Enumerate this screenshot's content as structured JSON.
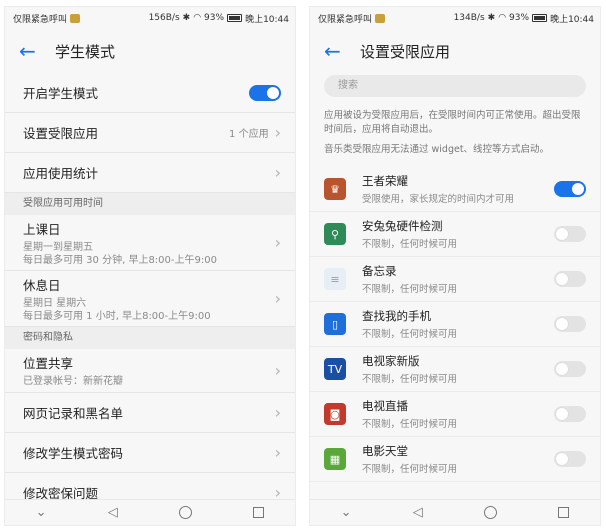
{
  "status_left": {
    "carrier": "仅限紧急呼叫",
    "speed": "156B/s",
    "battery": "93%",
    "time": "晚上10:44"
  },
  "status_right": {
    "carrier": "仅限紧急呼叫",
    "speed": "134B/s",
    "battery": "93%",
    "time": "晚上10:44"
  },
  "left": {
    "title": "学生模式",
    "rows_top": [
      {
        "title": "开启学生模式"
      },
      {
        "title": "设置受限应用",
        "value": "1 个应用"
      },
      {
        "title": "应用使用统计"
      }
    ],
    "section1": "受限应用可用时间",
    "schedule": [
      {
        "title": "上课日",
        "sub1": "星期一到星期五",
        "sub2": "每日最多可用 30 分钟, 早上8:00-上午9:00"
      },
      {
        "title": "休息日",
        "sub1": "星期日 星期六",
        "sub2": "每日最多可用 1 小时, 早上8:00-上午9:00"
      }
    ],
    "section2": "密码和隐私",
    "privacy": [
      {
        "title": "位置共享",
        "sub": "已登录帐号：新新花瓣"
      },
      {
        "title": "网页记录和黑名单"
      },
      {
        "title": "修改学生模式密码"
      },
      {
        "title": "修改密保问题"
      }
    ],
    "student_mode_on": true
  },
  "right": {
    "title": "设置受限应用",
    "search_placeholder": "搜索",
    "note1": "应用被设为受限应用后，在受限时间内可正常使用。超出受限时间后，应用将自动退出。",
    "note2": "音乐类受限应用无法通过 widget、线控等方式启动。",
    "apps": [
      {
        "name": "王者荣耀",
        "desc": "受限使用，家长规定的时间内才可用",
        "on": true,
        "icon": "game-icon",
        "color": "#b8552f"
      },
      {
        "name": "安兔兔硬件检测",
        "desc": "不限制，任何时候可用",
        "on": false,
        "icon": "magnifier-icon",
        "color": "#2e8b57"
      },
      {
        "name": "备忘录",
        "desc": "不限制，任何时候可用",
        "on": false,
        "icon": "memo-icon",
        "color": "#e8eef6"
      },
      {
        "name": "查找我的手机",
        "desc": "不限制，任何时候可用",
        "on": false,
        "icon": "phone-icon",
        "color": "#1e6fd9"
      },
      {
        "name": "电视家新版",
        "desc": "不限制，任何时候可用",
        "on": false,
        "icon": "tv-icon",
        "color": "#1b4fa3"
      },
      {
        "name": "电视直播",
        "desc": "不限制，任何时候可用",
        "on": false,
        "icon": "tv-live-icon",
        "color": "#c23a2b"
      },
      {
        "name": "电影天堂",
        "desc": "不限制，任何时候可用",
        "on": false,
        "icon": "movie-icon",
        "color": "#5aa83a"
      }
    ]
  },
  "colors": {
    "accent": "#1a73e8",
    "bg": "#f7f7f7"
  }
}
